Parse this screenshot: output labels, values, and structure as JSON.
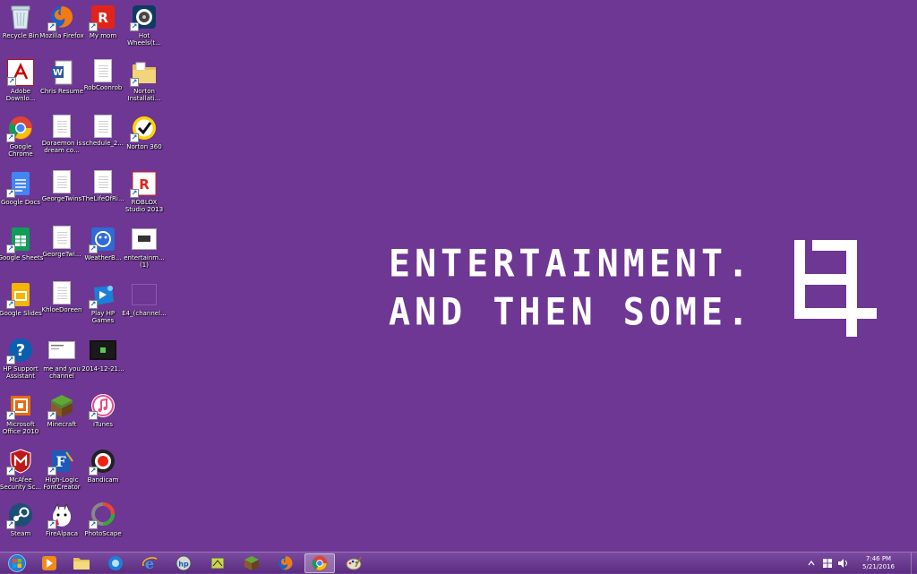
{
  "desktop": {
    "icons": [
      {
        "label": "Recycle Bin"
      },
      {
        "label": "Mozilla Firefox"
      },
      {
        "label": "My mom"
      },
      {
        "label": "Hot Wheels(t..."
      },
      {
        "label": "Adobe Downlo..."
      },
      {
        "label": "Chris Resume"
      },
      {
        "label": "RobCoonrob"
      },
      {
        "label": "Norton Installati..."
      },
      {
        "label": "Google Chrome"
      },
      {
        "label": "Doraemon is dream co..."
      },
      {
        "label": "schedule_2..."
      },
      {
        "label": "Norton 360"
      },
      {
        "label": "Google Docs"
      },
      {
        "label": "GeorgeTwins"
      },
      {
        "label": "TheLifeOfRi..."
      },
      {
        "label": "ROBLOX Studio 2013"
      },
      {
        "label": "Google Sheets"
      },
      {
        "label": "GeorgeTwi..."
      },
      {
        "label": "WeatherB..."
      },
      {
        "label": "entertainm... (1)"
      },
      {
        "label": "Google Slides"
      },
      {
        "label": "KhloeDoreen"
      },
      {
        "label": "Play HP Games"
      },
      {
        "label": "E4_(channel..."
      },
      {
        "label": "HP Support Assistant"
      },
      {
        "label": "me and you channel"
      },
      {
        "label": "2014-12-21..."
      },
      {
        "label": "Microsoft Office 2010"
      },
      {
        "label": "Minecraft"
      },
      {
        "label": "iTunes"
      },
      {
        "label": "McAfee Security Sc..."
      },
      {
        "label": "High-Logic FontCreator"
      },
      {
        "label": "Bandicam"
      },
      {
        "label": "Steam"
      },
      {
        "label": "FireAlpaca"
      },
      {
        "label": "PhotoScape"
      }
    ]
  },
  "wallpaper": {
    "line1": "ENTERTAINMENT.",
    "line2": "AND THEN SOME.",
    "background": "#6e3794"
  },
  "taskbar": {
    "clock_time": "7:46 PM",
    "clock_date": "5/21/2016"
  }
}
